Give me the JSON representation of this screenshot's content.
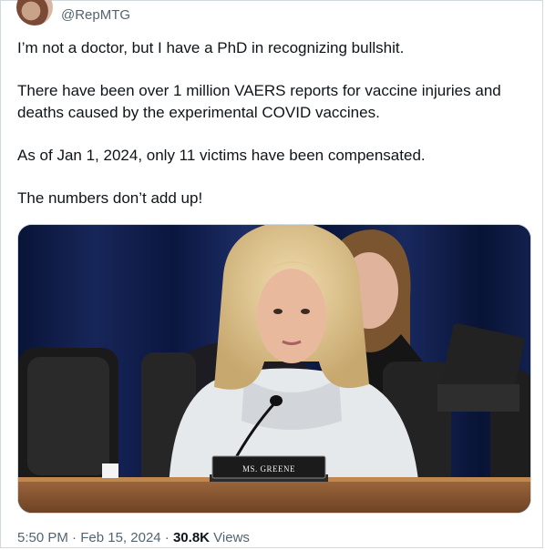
{
  "author": {
    "handle": "@RepMTG"
  },
  "tweet": {
    "paragraphs": [
      "I’m not a doctor, but I have a PhD in recognizing bullshit.",
      "There have been over 1 million VAERS reports for vaccine injuries and deaths caused by the experimental COVID vaccines.",
      "As of Jan 1, 2024, only 11 victims have been compensated.",
      "The numbers don’t add up!"
    ]
  },
  "media": {
    "nameplate": "MS. GREENE"
  },
  "meta": {
    "time": "5:50 PM",
    "separator1": "·",
    "date": "Feb 15, 2024",
    "separator2": "·",
    "views_count": "30.8K",
    "views_label": "Views"
  }
}
